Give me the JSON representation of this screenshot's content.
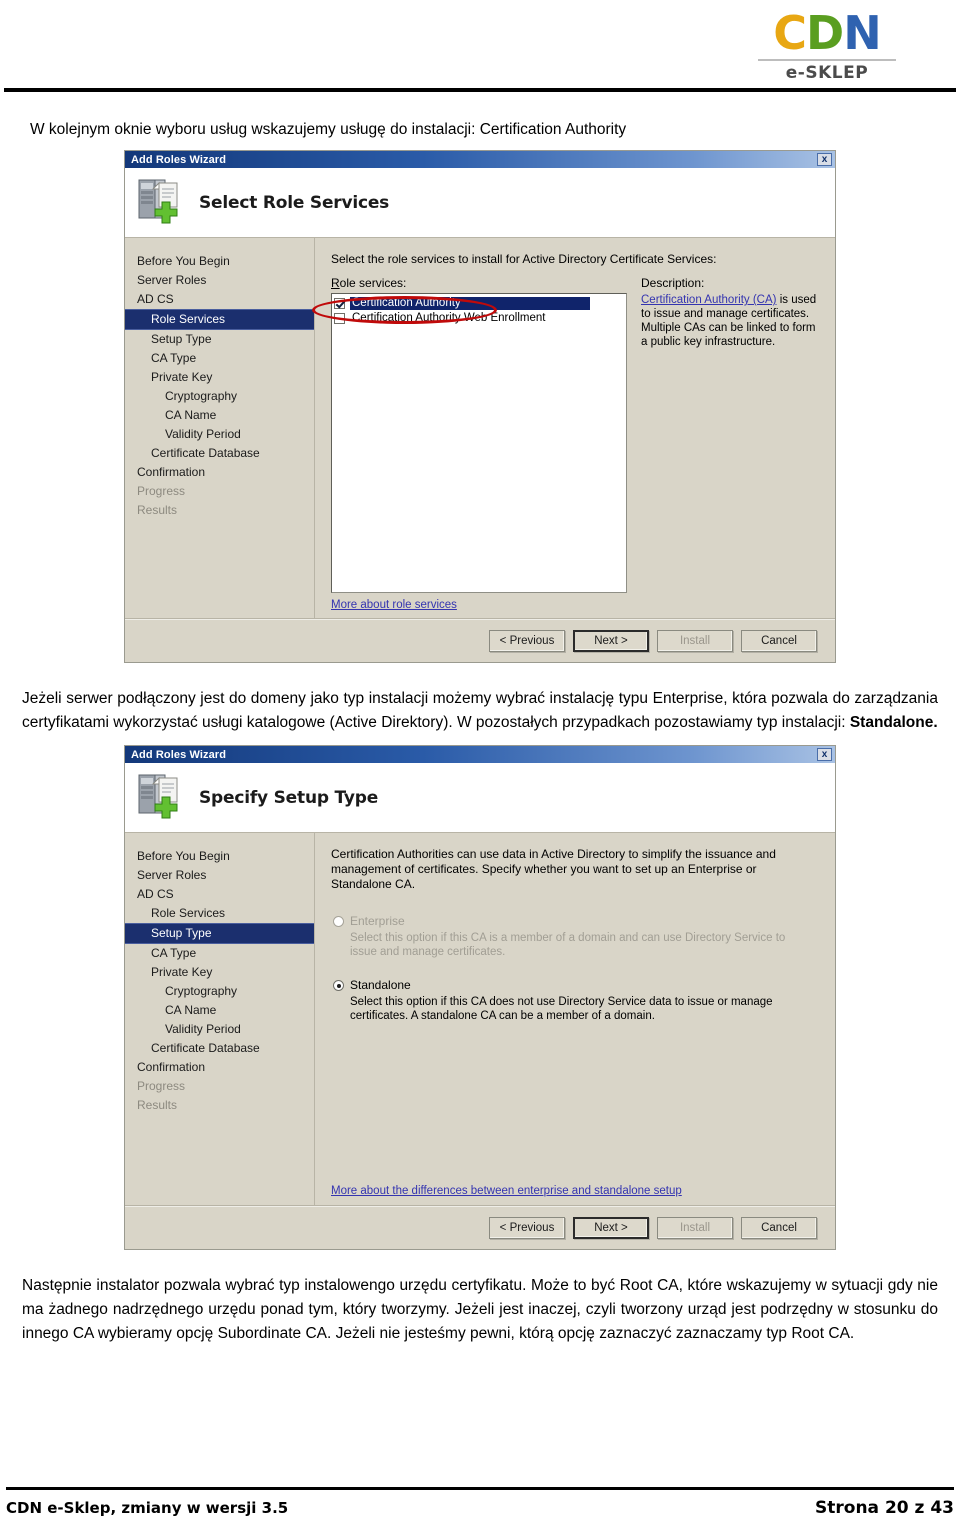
{
  "brand": {
    "logo_c": "C",
    "logo_d": "D",
    "logo_n": "N",
    "logo_sub": "e-SKLEP",
    "colors": {
      "c": "#e8a713",
      "d": "#5a9e20",
      "n": "#2f62b0",
      "annotation": "#c00a0a"
    }
  },
  "intro": "W kolejnym oknie wyboru usług wskazujemy usługę do instalacji: Certification Authority",
  "paragraph_1": {
    "text": "Jeżeli serwer podłączony jest do domeny jako typ instalacji możemy wybrać instalację typu Enterprise, która pozwala do zarządzania certyfikatami wykorzystać usługi katalogowe (Active Direktory). W pozostałych przypadkach pozostawiamy typ instalacji: ",
    "bold_tail": "Standalone."
  },
  "paragraph_2": "Następnie instalator pozwala wybrać typ instalowengo urzędu certyfikatu. Może to być Root CA, które wskazujemy w sytuacji gdy nie ma żadnego nadrzędnego urzędu ponad tym, który tworzymy. Jeżeli jest inaczej, czyli tworzony urząd jest podrzędny w stosunku do innego CA wybieramy opcję Subordinate CA. Jeżeli nie jesteśmy pewni, którą opcję zaznaczyć zaznaczamy typ Root CA.",
  "wizard1": {
    "window_title": "Add Roles Wizard",
    "close_label": "x",
    "banner_title": "Select Role Services",
    "nav": [
      {
        "label": "Before You Begin",
        "level": 0,
        "state": "normal"
      },
      {
        "label": "Server Roles",
        "level": 0,
        "state": "normal"
      },
      {
        "label": "AD CS",
        "level": 0,
        "state": "normal"
      },
      {
        "label": "Role Services",
        "level": 1,
        "state": "selected"
      },
      {
        "label": "Setup Type",
        "level": 1,
        "state": "normal"
      },
      {
        "label": "CA Type",
        "level": 1,
        "state": "normal"
      },
      {
        "label": "Private Key",
        "level": 1,
        "state": "normal"
      },
      {
        "label": "Cryptography",
        "level": 2,
        "state": "normal"
      },
      {
        "label": "CA Name",
        "level": 2,
        "state": "normal"
      },
      {
        "label": "Validity Period",
        "level": 2,
        "state": "normal"
      },
      {
        "label": "Certificate Database",
        "level": 1,
        "state": "normal"
      },
      {
        "label": "Confirmation",
        "level": 0,
        "state": "normal"
      },
      {
        "label": "Progress",
        "level": 0,
        "state": "disabled"
      },
      {
        "label": "Results",
        "level": 0,
        "state": "disabled"
      }
    ],
    "lead": "Select the role services to install for Active Directory Certificate Services:",
    "role_services_label": "Role services:",
    "role_services": [
      {
        "label": "Certification Authority",
        "checked": true,
        "selected": true
      },
      {
        "label": "Certification Authority Web Enrollment",
        "checked": false,
        "selected": false
      }
    ],
    "description_label": "Description:",
    "description_link": "Certification Authority (CA)",
    "description_text": " is used to issue and manage certificates. Multiple CAs can be linked to form a public key infrastructure.",
    "more_link": "More about role services",
    "buttons": [
      {
        "label": "< Previous",
        "state": "normal"
      },
      {
        "label": "Next >",
        "state": "default"
      },
      {
        "label": "Install",
        "state": "disabled"
      },
      {
        "label": "Cancel",
        "state": "normal"
      }
    ]
  },
  "wizard2": {
    "window_title": "Add Roles Wizard",
    "close_label": "x",
    "banner_title": "Specify Setup Type",
    "nav": [
      {
        "label": "Before You Begin",
        "level": 0,
        "state": "normal"
      },
      {
        "label": "Server Roles",
        "level": 0,
        "state": "normal"
      },
      {
        "label": "AD CS",
        "level": 0,
        "state": "normal"
      },
      {
        "label": "Role Services",
        "level": 1,
        "state": "normal"
      },
      {
        "label": "Setup Type",
        "level": 1,
        "state": "selected"
      },
      {
        "label": "CA Type",
        "level": 1,
        "state": "normal"
      },
      {
        "label": "Private Key",
        "level": 1,
        "state": "normal"
      },
      {
        "label": "Cryptography",
        "level": 2,
        "state": "normal"
      },
      {
        "label": "CA Name",
        "level": 2,
        "state": "normal"
      },
      {
        "label": "Validity Period",
        "level": 2,
        "state": "normal"
      },
      {
        "label": "Certificate Database",
        "level": 1,
        "state": "normal"
      },
      {
        "label": "Confirmation",
        "level": 0,
        "state": "normal"
      },
      {
        "label": "Progress",
        "level": 0,
        "state": "disabled"
      },
      {
        "label": "Results",
        "level": 0,
        "state": "disabled"
      }
    ],
    "lead": "Certification Authorities can use data in Active Directory to simplify the issuance and management of certificates. Specify whether you want to set up an Enterprise or Standalone CA.",
    "options": [
      {
        "label": "Enterprise",
        "selected": false,
        "disabled": true,
        "description": "Select this option if this CA is a member of a domain and can use Directory Service to issue and manage certificates."
      },
      {
        "label": "Standalone",
        "selected": true,
        "disabled": false,
        "description": "Select this option if this CA does not use Directory Service data to issue or manage certificates. A standalone CA can be a member of a domain."
      }
    ],
    "more_link": "More about the differences between enterprise and standalone setup",
    "buttons": [
      {
        "label": "< Previous",
        "state": "normal"
      },
      {
        "label": "Next >",
        "state": "default"
      },
      {
        "label": "Install",
        "state": "disabled"
      },
      {
        "label": "Cancel",
        "state": "normal"
      }
    ]
  },
  "footer": {
    "left": "CDN e-Sklep, zmiany w wersji 3.5",
    "right": "Strona 20 z 43"
  }
}
